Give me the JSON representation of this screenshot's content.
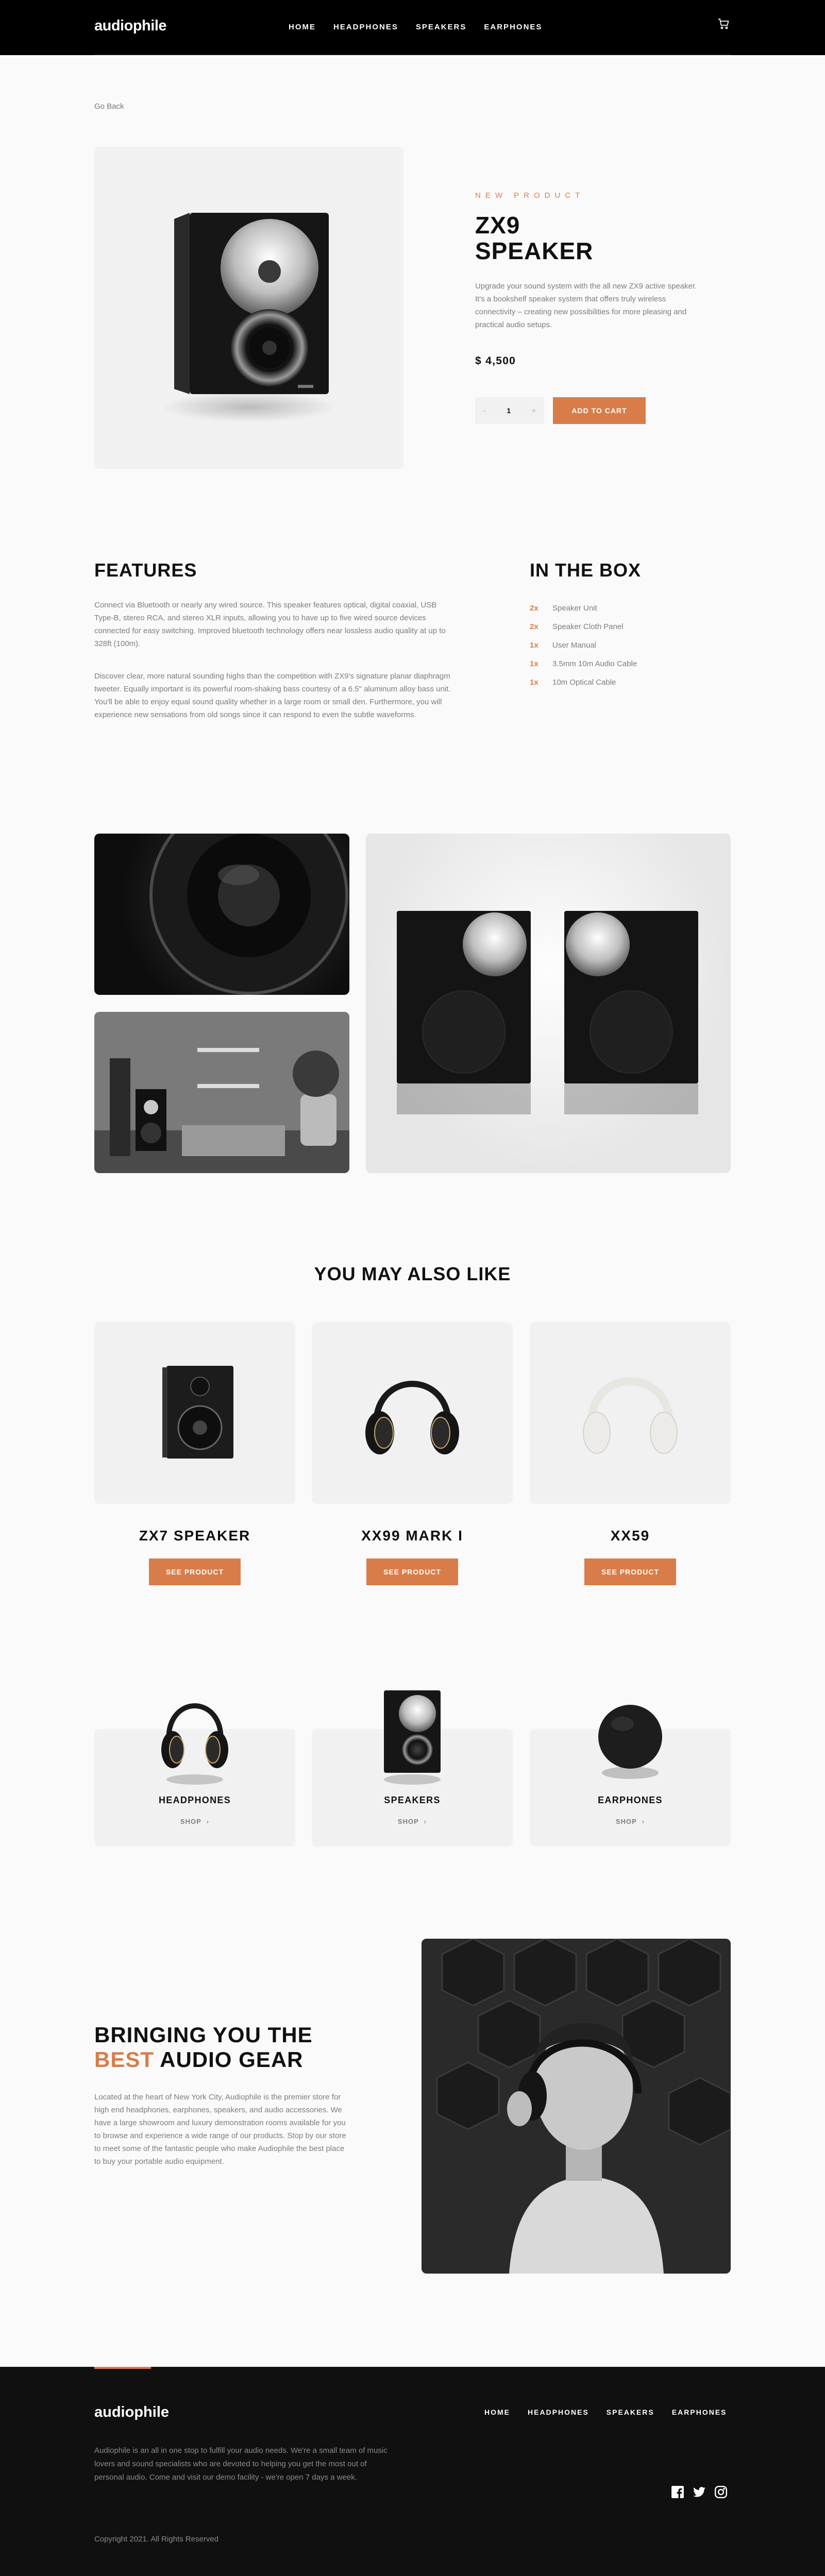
{
  "header": {
    "logo": "audiophile",
    "nav": [
      "HOME",
      "HEADPHONES",
      "SPEAKERS",
      "EARPHONES"
    ],
    "cart_icon": "cart-icon"
  },
  "go_back": "Go Back",
  "product": {
    "overline": "NEW PRODUCT",
    "title": "ZX9 SPEAKER",
    "description": "Upgrade your sound system with the all new ZX9 active speaker. It's a bookshelf speaker system that offers truly wireless connectivity – creating new possibilities for more pleasing and practical audio setups.",
    "price": "$ 4,500",
    "quantity": "1",
    "minus": "-",
    "plus": "+",
    "add_to_cart": "ADD TO CART"
  },
  "features": {
    "heading": "FEATURES",
    "p1": "Connect via Bluetooth or nearly any wired source. This speaker features optical, digital coaxial, USB Type-B, stereo RCA, and stereo XLR inputs, allowing you to have up to five wired source devices connected for easy switching. Improved bluetooth technology offers near lossless audio quality at up to 328ft (100m).",
    "p2": "Discover clear, more natural sounding highs than the competition with ZX9's signature planar diaphragm tweeter. Equally important is its powerful room-shaking bass courtesy of a 6.5\" aluminum alloy bass unit. You'll be able to enjoy equal sound quality whether in a large room or small den. Furthermore, you will experience new sensations from old songs since it can respond to even the subtle waveforms."
  },
  "in_the_box": {
    "heading": "IN THE BOX",
    "items": [
      {
        "qty": "2x",
        "name": "Speaker Unit"
      },
      {
        "qty": "2x",
        "name": "Speaker Cloth Panel"
      },
      {
        "qty": "1x",
        "name": "User Manual"
      },
      {
        "qty": "1x",
        "name": "3.5mm 10m Audio Cable"
      },
      {
        "qty": "1x",
        "name": "10m Optical Cable"
      }
    ]
  },
  "also_like": {
    "heading": "YOU MAY ALSO LIKE",
    "items": [
      {
        "name": "ZX7 SPEAKER",
        "button": "SEE PRODUCT"
      },
      {
        "name": "XX99 MARK I",
        "button": "SEE PRODUCT"
      },
      {
        "name": "XX59",
        "button": "SEE PRODUCT"
      }
    ]
  },
  "categories": [
    {
      "name": "HEADPHONES",
      "shop": "SHOP"
    },
    {
      "name": "SPEAKERS",
      "shop": "SHOP"
    },
    {
      "name": "EARPHONES",
      "shop": "SHOP"
    }
  ],
  "about": {
    "heading_pre": "BRINGING YOU THE",
    "heading_accent": "BEST",
    "heading_post": "AUDIO GEAR",
    "text": "Located at the heart of New York City, Audiophile is the premier store for high end headphones, earphones, speakers, and audio accessories. We have a large showroom and luxury demonstration rooms available for you to browse and experience a wide range of our products. Stop by our store to meet some of the fantastic people who make Audiophile the best place to buy your portable audio equipment."
  },
  "footer": {
    "logo": "audiophile",
    "nav": [
      "HOME",
      "HEADPHONES",
      "SPEAKERS",
      "EARPHONES"
    ],
    "description": "Audiophile is an all in one stop to fulfill your audio needs. We're a small team of music lovers and sound specialists who are devoted to helping you get the most out of personal audio. Come and visit our demo facility - we're open 7 days a week.",
    "copyright": "Copyright 2021. All Rights Reserved",
    "social_icons": [
      "facebook-icon",
      "twitter-icon",
      "instagram-icon"
    ]
  },
  "colors": {
    "accent": "#D87D4A",
    "dark": "#101010",
    "light_gray": "#F1F1F1",
    "bg": "#FAFAFA"
  }
}
